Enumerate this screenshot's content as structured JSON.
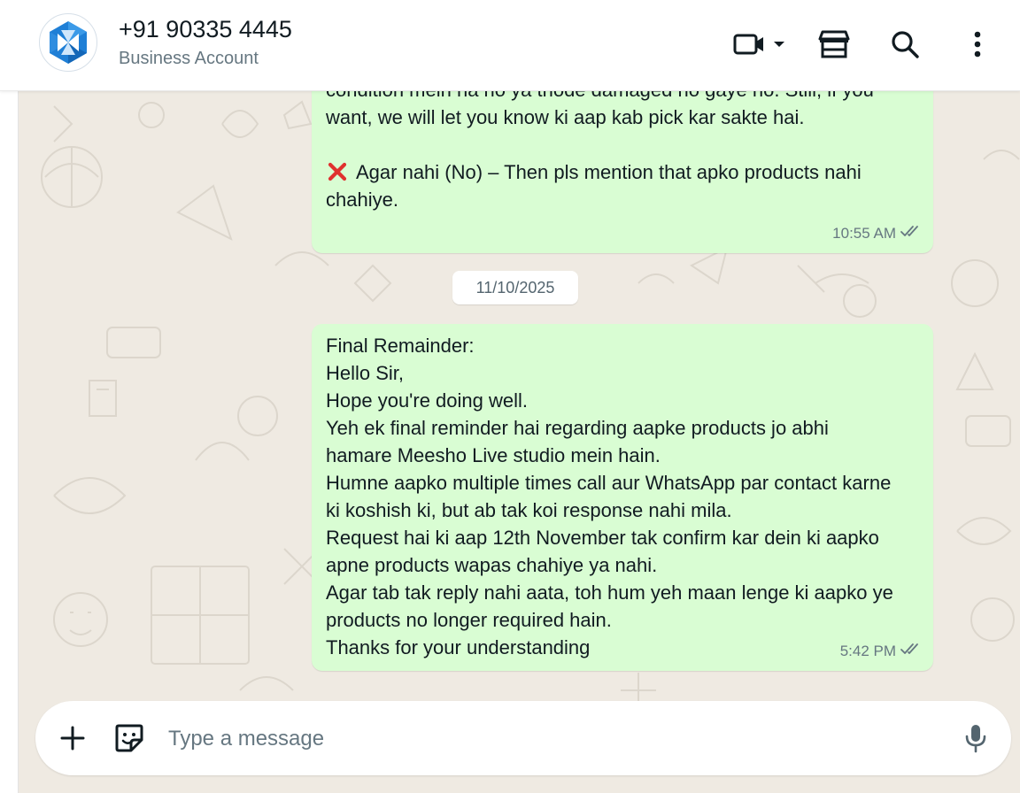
{
  "header": {
    "contact_name": "+91 90335 4445",
    "contact_subtitle": "Business Account",
    "icons": [
      "video-call-icon",
      "dropdown-arrow-icon",
      "store-icon",
      "search-icon",
      "more-options-icon"
    ]
  },
  "messages": [
    {
      "lines": [
        "condition mein na ho ya thode damaged ho gaye ho. Still, if you",
        "want, we will let you know ki aap kab pick kar sakte hai.",
        "",
        "Agar nahi (No) – Then pls mention that apko products nahi",
        "chahiye."
      ],
      "time": "10:55 AM",
      "status": "read"
    },
    {
      "lines": [
        "Final Remainder:",
        "Hello Sir,",
        "Hope you're doing well.",
        "Yeh ek final reminder hai regarding aapke products jo abhi",
        "hamare Meesho Live studio mein hain.",
        "Humne aapko multiple times call aur WhatsApp par contact karne",
        "ki koshish ki, but ab tak koi response nahi mila.",
        "Request hai ki aap 12th November tak confirm kar dein ki aapko",
        "apne products wapas chahiye ya nahi.",
        "Agar tab tak reply nahi aata, toh hum yeh maan lenge ki aapko ye",
        "products no longer required hain.",
        "Thanks for your understanding"
      ],
      "time": "5:42 PM",
      "status": "read"
    }
  ],
  "date_divider": "11/10/2025",
  "composer": {
    "placeholder": "Type a message",
    "value": ""
  },
  "colors": {
    "outgoing_bubble": "#d9fdd3",
    "chat_background": "#efeae2",
    "read_tick": "#667781",
    "cross_mark": "#e0312e"
  }
}
